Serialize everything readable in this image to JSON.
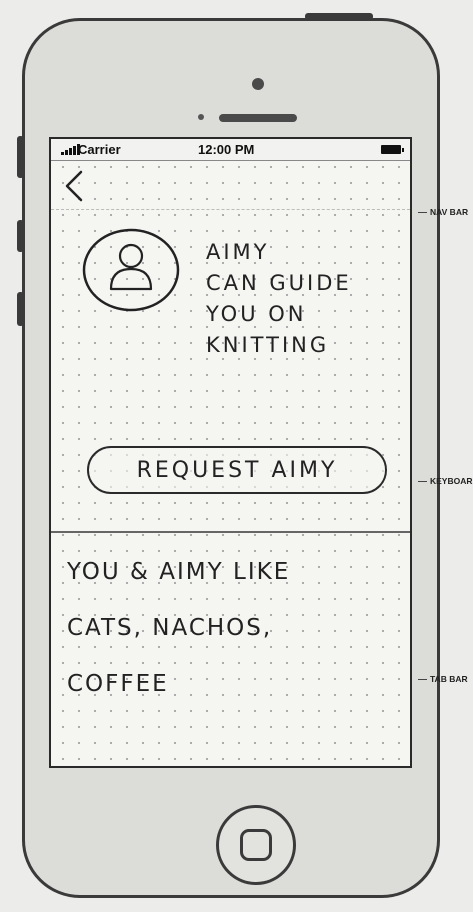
{
  "status_bar": {
    "carrier": "Carrier",
    "time": "12:00 PM"
  },
  "nav_bar": {
    "back_icon": "chevron-left-icon"
  },
  "profile": {
    "avatar_icon": "user-avatar-icon",
    "message_lines": [
      "AIMY",
      "CAN GUIDE",
      "YOU ON",
      "KNITTING"
    ]
  },
  "request_button": {
    "label": "REQUEST AIMY"
  },
  "shared_interests": {
    "lines": [
      "YOU & AIMY LIKE",
      "CATS, NACHOS,",
      "COFFEE"
    ]
  },
  "annotations": {
    "nav_bar": "NAV BAR",
    "keyboard": "KEYBOARD",
    "tab_bar": "TAB BAR"
  },
  "device": {
    "home_button_icon": "home-button-icon",
    "colors": {
      "frame": "#3a3a3a",
      "screen": "#f5f5f2"
    }
  }
}
